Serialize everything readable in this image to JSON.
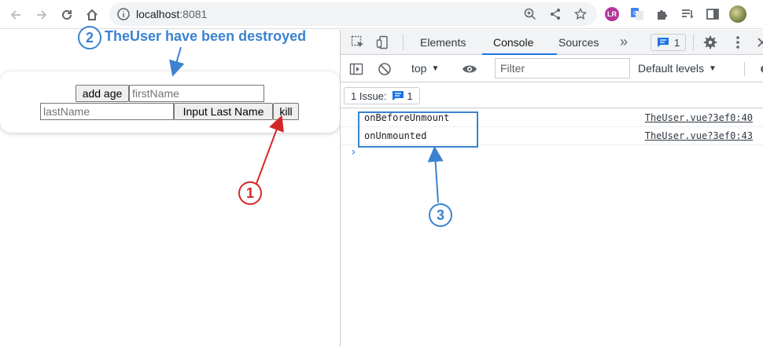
{
  "browser": {
    "url_host": "localhost",
    "url_port": ":8081",
    "colors": {
      "toolbar_bg": "#ffffff",
      "omnibox_bg": "#f1f3f4"
    }
  },
  "app": {
    "add_age_label": "add age",
    "first_name_placeholder": "firstName",
    "last_name_placeholder": "lastName",
    "input_last_name_label": "Input Last Name",
    "kill_label": "kill"
  },
  "annotations": {
    "circle_1": "1",
    "circle_2": "2",
    "circle_3": "3",
    "destroyed_text": "TheUser have been destroyed",
    "colors": {
      "red": "#d62728",
      "blue": "#3b82d0"
    }
  },
  "devtools": {
    "tabs": [
      "Elements",
      "Console",
      "Sources"
    ],
    "active_tab": "Console",
    "more_tabs": "»",
    "message_badge_count": "1",
    "context": "top",
    "filter_placeholder": "Filter",
    "levels": "Default levels",
    "issue_label": "1 Issue:",
    "issue_count": "1",
    "logs": [
      {
        "message": "onBeforeUnmount",
        "source": "TheUser.vue?3ef0:40"
      },
      {
        "message": "onUnmounted",
        "source": "TheUser.vue?3ef0:43"
      }
    ],
    "prompt": "›",
    "colors": {
      "accent": "#1a73e8"
    }
  }
}
